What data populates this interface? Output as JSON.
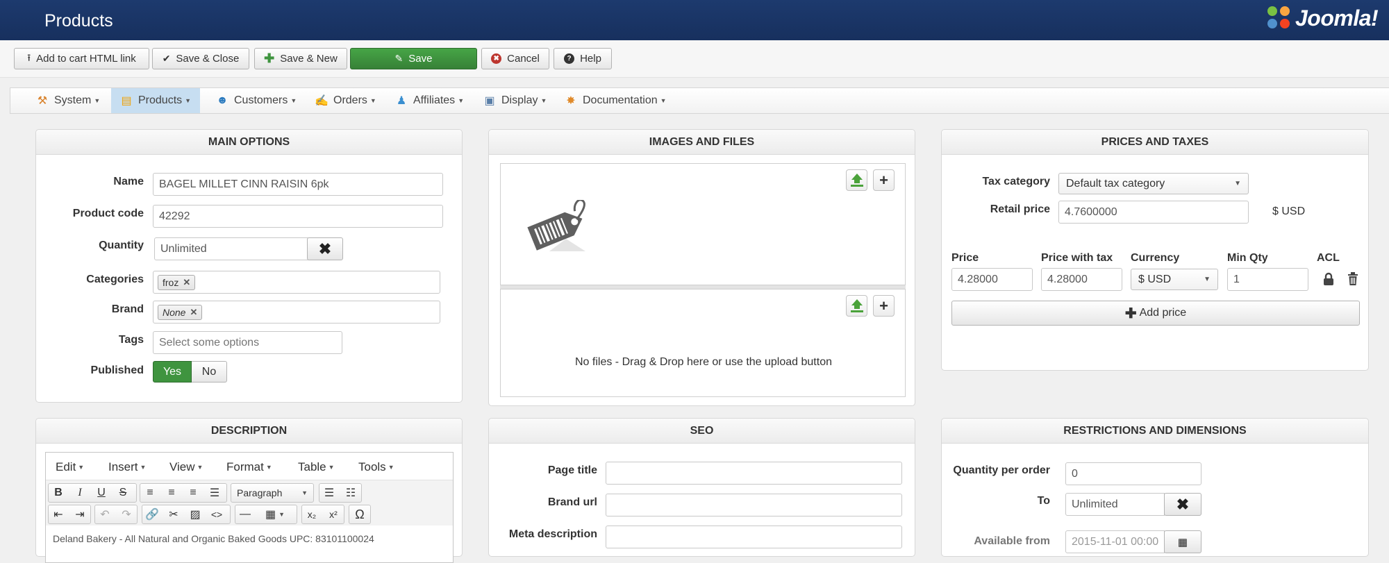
{
  "header": {
    "title": "Products",
    "brand": "Joomla!"
  },
  "toolbar": {
    "add_to_cart": "Add to cart HTML link",
    "save_close": "Save & Close",
    "save_new": "Save & New",
    "save": "Save",
    "cancel": "Cancel",
    "help": "Help"
  },
  "menu": {
    "system": "System",
    "products": "Products",
    "customers": "Customers",
    "orders": "Orders",
    "affiliates": "Affiliates",
    "display": "Display",
    "documentation": "Documentation"
  },
  "main_options": {
    "heading": "MAIN OPTIONS",
    "name_label": "Name",
    "name_value": "BAGEL MILLET CINN RAISIN 6pk",
    "code_label": "Product code",
    "code_value": "42292",
    "qty_label": "Quantity",
    "qty_value": "Unlimited",
    "categories_label": "Categories",
    "category_chip": "froz",
    "brand_label": "Brand",
    "brand_chip": "None",
    "tags_label": "Tags",
    "tags_placeholder": "Select some options",
    "published_label": "Published",
    "yes": "Yes",
    "no": "No"
  },
  "images": {
    "heading": "IMAGES AND FILES",
    "no_files": "No files - Drag & Drop here or use the upload button"
  },
  "prices": {
    "heading": "PRICES AND TAXES",
    "tax_label": "Tax category",
    "tax_value": "Default tax category",
    "retail_label": "Retail price",
    "retail_value": "4.7600000",
    "retail_currency": "$ USD",
    "col_price": "Price",
    "col_price_tax": "Price with tax",
    "col_currency": "Currency",
    "col_min_qty": "Min Qty",
    "col_acl": "ACL",
    "price_value": "4.28000",
    "price_tax_value": "4.28000",
    "currency_value": "$ USD",
    "min_qty_value": "1",
    "add_price": "Add price"
  },
  "description": {
    "heading": "DESCRIPTION",
    "menus": [
      "Edit",
      "Insert",
      "View",
      "Format",
      "Table",
      "Tools"
    ],
    "paragraph": "Paragraph",
    "content": "Deland Bakery - All Natural and Organic Baked Goods UPC: 83101100024"
  },
  "seo": {
    "heading": "SEO",
    "page_title_label": "Page title",
    "brand_url_label": "Brand url",
    "meta_desc_label": "Meta description"
  },
  "restrictions": {
    "heading": "RESTRICTIONS AND DIMENSIONS",
    "qty_per_order_label": "Quantity per order",
    "qty_per_order_value": "0",
    "to_label": "To",
    "to_value": "Unlimited",
    "available_from_label": "Available from",
    "available_from_value": "2015-11-01 00:00"
  }
}
